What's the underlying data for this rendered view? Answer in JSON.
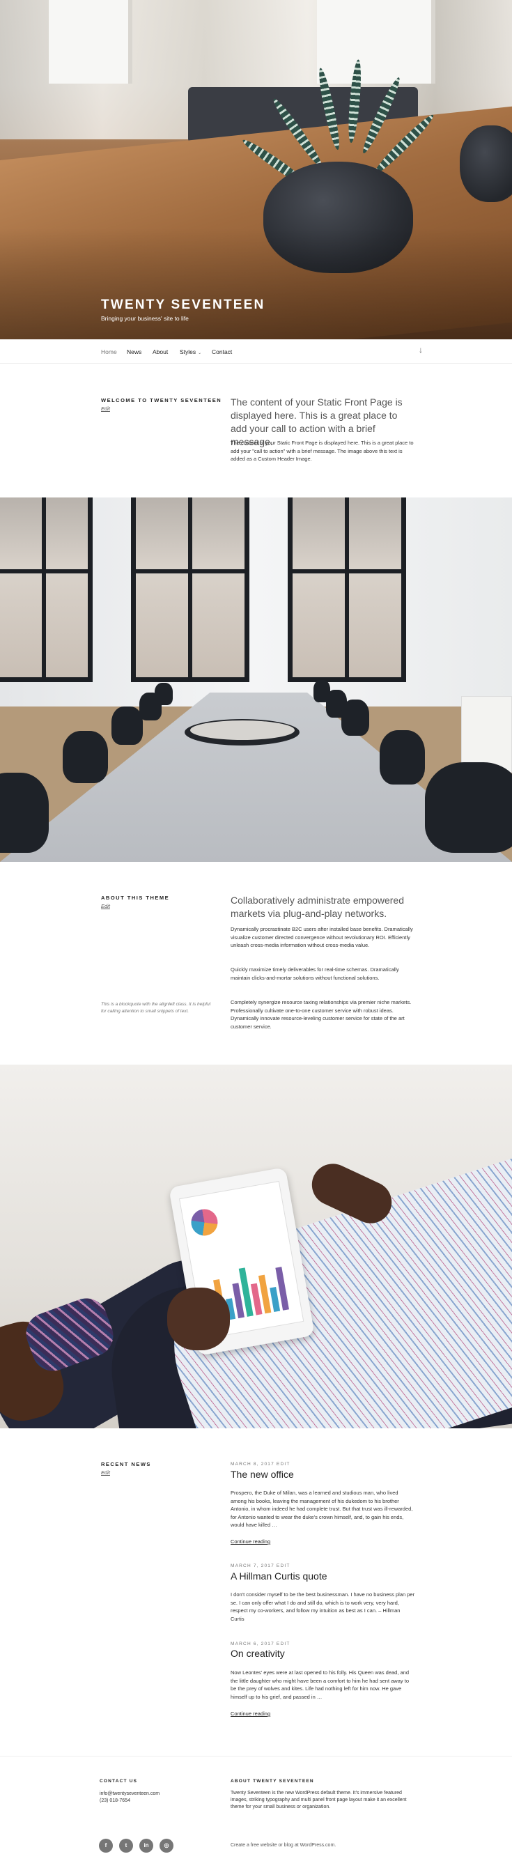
{
  "site": {
    "title": "TWENTY SEVENTEEN",
    "description": "Bringing your business' site to life"
  },
  "nav": {
    "items": [
      "Home",
      "News",
      "About",
      "Styles",
      "Contact"
    ],
    "current": "Home",
    "scroll_icon": "arrow-down-icon"
  },
  "welcome": {
    "heading": "WELCOME TO TWENTY SEVENTEEN",
    "edit": "Edit",
    "lead": "The content of your Static Front Page is displayed here. This is a great place to add your call to action with a brief message.",
    "body": "The content of your Static Front Page is displayed here. This is a great place to add your \"call to action\" with a brief message. The image above this text is added as a Custom Header Image."
  },
  "about": {
    "heading": "ABOUT THIS THEME",
    "edit": "Edit",
    "lead": "Collaboratively administrate empowered markets via plug-and-play networks.",
    "p1": "Dynamically procrastinate B2C users after installed base benefits. Dramatically visualize customer directed convergence without revolutionary ROI. Efficiently unleash cross-media information without cross-media value.",
    "p2": "Quickly maximize timely deliverables for real-time schemas. Dramatically maintain clicks-and-mortar solutions without functional solutions.",
    "p3": "Completely synergize resource taxing relationships via premier niche markets. Professionally cultivate one-to-one customer service with robust ideas. Dynamically innovate resource-leveling customer service for state of the art customer service.",
    "blockquote": "This is a blockquote with the alignleft class. It is helpful for calling attention to small snippets of text."
  },
  "news": {
    "heading": "RECENT NEWS",
    "edit": "Edit",
    "posts": [
      {
        "meta": "MARCH 8, 2017   EDIT",
        "title": "The new office",
        "excerpt": "Prospero, the Duke of Milan, was a learned and studious man, who lived among his books, leaving the management of his dukedom to his brother Antonio, in whom indeed he had complete trust. But that trust was ill-rewarded, for Antonio wanted to wear the duke's crown himself, and, to gain his ends, would have killed …",
        "more": "Continue reading"
      },
      {
        "meta": "MARCH 7, 2017   EDIT",
        "title": "A Hillman Curtis quote",
        "excerpt": "I don't consider myself to be the best businessman. I have no business plan per se. I can only offer what I do and still do, which is to work very, very hard, respect my co-workers, and follow my intuition as best as I can. – Hillman Curtis",
        "more": ""
      },
      {
        "meta": "MARCH 6, 2017   EDIT",
        "title": "On creativity",
        "excerpt": "Now Leontes' eyes were at last opened to his folly. His Queen was dead, and the little daughter who might have been a comfort to him he had sent away to be the prey of wolves and kites. Life had nothing left for him now. He gave himself up to his grief, and passed in …",
        "more": "Continue reading"
      }
    ]
  },
  "footer": {
    "contact_heading": "CONTACT US",
    "email": "info@twentyseventeen.com",
    "phone": "(23) 018-7654",
    "about_heading": "ABOUT TWENTY SEVENTEEN",
    "about_text": "Twenty Seventeen is the new WordPress default theme. It's immersive featured images, striking typography and multi panel front page layout make it an excellent theme for your small business or organization.",
    "social": [
      {
        "label": "f",
        "icon": "facebook-icon"
      },
      {
        "label": "t",
        "icon": "twitter-icon"
      },
      {
        "label": "in",
        "icon": "linkedin-icon"
      },
      {
        "label": "◎",
        "icon": "instagram-icon"
      }
    ],
    "credit": "Create a free website or blog at WordPress.com."
  },
  "colors": {
    "text": "#333333",
    "muted": "#767676",
    "white": "#ffffff"
  }
}
